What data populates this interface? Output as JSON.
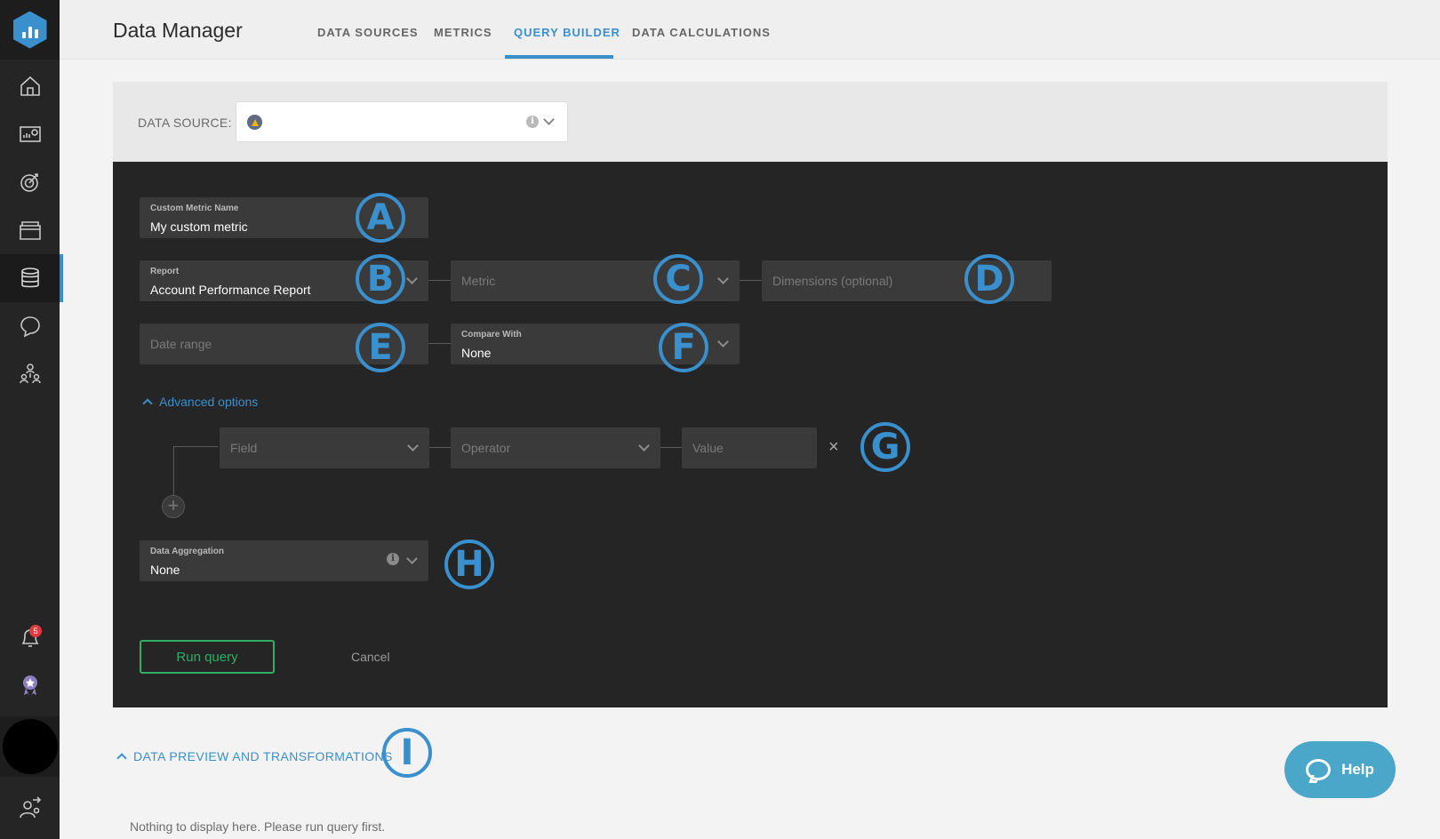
{
  "app": {
    "title": "Data Manager",
    "tabs": [
      {
        "label": "DATA SOURCES",
        "active": false
      },
      {
        "label": "METRICS",
        "active": false
      },
      {
        "label": "QUERY BUILDER",
        "active": true
      },
      {
        "label": "DATA CALCULATIONS",
        "active": false
      }
    ]
  },
  "sidebar": {
    "items": [
      {
        "icon": "home-icon"
      },
      {
        "icon": "dashboard-icon"
      },
      {
        "icon": "goals-icon"
      },
      {
        "icon": "folder-icon"
      },
      {
        "icon": "database-icon",
        "active": true
      },
      {
        "icon": "chat-icon"
      },
      {
        "icon": "team-icon"
      }
    ],
    "notifications": {
      "icon": "bell-icon",
      "count": "5"
    },
    "rewards": {
      "icon": "medal-icon"
    },
    "profile": {
      "icon": "avatar"
    },
    "admin": {
      "icon": "user-switch-icon"
    }
  },
  "data_source": {
    "label": "DATA SOURCE:",
    "value_icon": "google-ads-icon",
    "info_glyph": "i"
  },
  "form": {
    "custom_metric_label": "Custom Metric Name",
    "custom_metric_value": "My custom metric",
    "report_label": "Report",
    "report_value": "Account Performance Report",
    "metric_placeholder": "Metric",
    "dimensions_placeholder": "Dimensions (optional)",
    "date_range_placeholder": "Date range",
    "compare_label": "Compare With",
    "compare_value": "None",
    "advanced_label": "Advanced options",
    "field_placeholder": "Field",
    "operator_placeholder": "Operator",
    "value_placeholder": "Value",
    "remove_glyph": "×",
    "add_glyph": "+",
    "aggregation_label": "Data Aggregation",
    "aggregation_value": "None",
    "run_label": "Run query",
    "cancel_label": "Cancel"
  },
  "markers": [
    "A",
    "B",
    "C",
    "D",
    "E",
    "F",
    "G",
    "H",
    "I"
  ],
  "bottom": {
    "preview_label": "DATA PREVIEW AND TRANSFORMATIONS",
    "empty_message": "Nothing to display here. Please run query first."
  },
  "help": {
    "label": "Help"
  },
  "colors": {
    "accent": "#3a8fcd",
    "sidebar": "#252526",
    "run": "#2fae64",
    "help": "#4aa7c9"
  }
}
